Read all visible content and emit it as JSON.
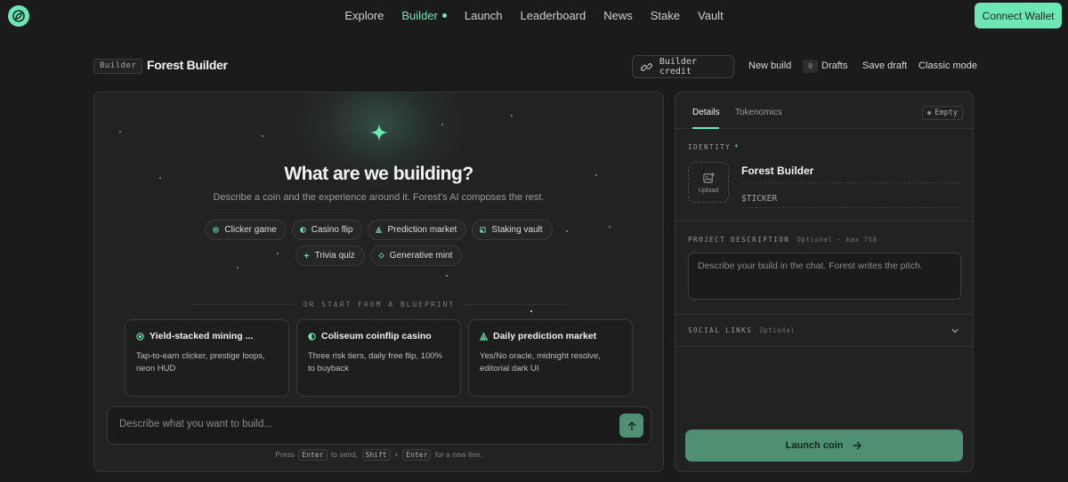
{
  "nav": {
    "links": [
      "Explore",
      "Builder",
      "Launch",
      "Leaderboard",
      "News",
      "Stake",
      "Vault"
    ],
    "active": "Builder",
    "connect_label": "Connect Wallet"
  },
  "header": {
    "tag": "Builder",
    "title": "Forest Builder",
    "credit_label": "Builder credit",
    "new_build": "New build",
    "drafts_count": "0",
    "drafts_label": "Drafts",
    "save_draft": "Save draft",
    "classic_mode": "Classic mode"
  },
  "hero": {
    "title": "What are we building?",
    "subtitle": "Describe a coin and the experience around it. Forest's AI composes the rest.",
    "chips_row1": [
      {
        "label": "Clicker game",
        "icon": "circle-dot-icon"
      },
      {
        "label": "Casino flip",
        "icon": "half-circle-icon"
      },
      {
        "label": "Prediction market",
        "icon": "triangle-icon"
      },
      {
        "label": "Staking vault",
        "icon": "square-icon"
      }
    ],
    "chips_row2": [
      {
        "label": "Trivia quiz",
        "icon": "plus-icon"
      },
      {
        "label": "Generative mint",
        "icon": "diamond-icon"
      }
    ],
    "divider": "OR START FROM A BLUEPRINT"
  },
  "blueprints": [
    {
      "title": "Yield-stacked mining ...",
      "desc": "Tap-to-earn clicker, prestige loops, neon HUD",
      "icon": "circle-dot-icon"
    },
    {
      "title": "Coliseum coinflip casino",
      "desc": "Three risk tiers, daily free flip, 100% to buyback",
      "icon": "half-circle-icon"
    },
    {
      "title": "Daily prediction market",
      "desc": "Yes/No oracle, midnight resolve, editorial dark UI",
      "icon": "triangle-icon"
    }
  ],
  "prompt": {
    "placeholder": "Describe what you want to build...",
    "hint_press": "Press",
    "hint_enter": "Enter",
    "hint_to_send": "to send,",
    "hint_shift": "Shift",
    "hint_plus": "+",
    "hint_newline": "for a new line."
  },
  "right": {
    "tabs": [
      "Details",
      "Tokenomics"
    ],
    "empty_badge": "Empty",
    "identity_label": "IDENTITY",
    "identity_mark": "*",
    "upload_label": "Upload",
    "name_value": "Forest Builder",
    "ticker_placeholder": "$TICKER",
    "desc_label": "PROJECT DESCRIPTION",
    "desc_meta": "Optional · max 750",
    "desc_placeholder": "Describe your build in the chat. Forest writes the pitch.",
    "social_label": "SOCIAL LINKS",
    "social_meta": "Optional",
    "launch_label": "Launch coin"
  },
  "colors": {
    "accent": "#6ee7b7",
    "launch": "#4f8f72",
    "background": "#1b1b1b",
    "panel": "#222222"
  }
}
